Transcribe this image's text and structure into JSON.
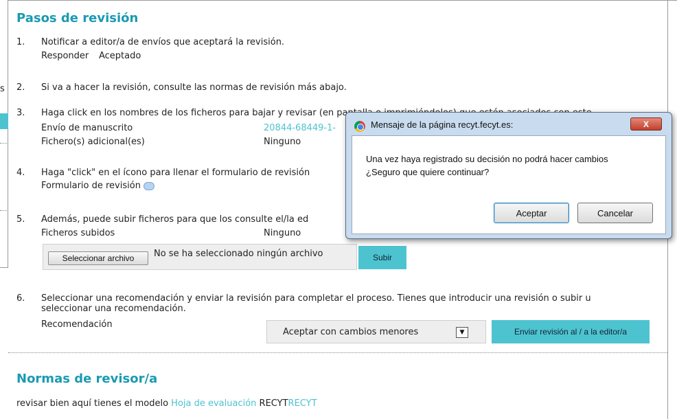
{
  "background_fragment": {
    "text": "s"
  },
  "section_title": "Pasos de revisión",
  "steps": [
    {
      "num": "1.",
      "text": "Notificar a editor/a de envíos que aceptará la revisión.",
      "sub": [
        "Responder",
        "Aceptado"
      ]
    },
    {
      "num": "2.",
      "text": "Si va a hacer la revisión, consulte las normas de revisión más abajo."
    },
    {
      "num": "3.",
      "text": "Haga click en los nombres de los ficheros para bajar y revisar (en pantalla o imprimiéndolos) que estén asociados con este",
      "rows": [
        {
          "label": "Envío de manuscrito",
          "value": "20844-68449-1-"
        },
        {
          "label": "Fichero(s) adicional(es)",
          "value": "Ninguno"
        }
      ]
    },
    {
      "num": "4.",
      "text": "Haga \"click\" en el ícono para llenar el formulario de revisión",
      "sub_label": "Formulario de revisión"
    },
    {
      "num": "5.",
      "text": "Además, puede subir ficheros para que los consulte el/la ed",
      "row": {
        "label": "Ficheros subidos",
        "value": "Ninguno"
      },
      "file_button": "Seleccionar archivo",
      "file_status": "No se ha seleccionado ningún archivo",
      "upload_button": "Subir"
    },
    {
      "num": "6.",
      "text": "Seleccionar una recomendación y enviar la revisión para completar el proceso. Tienes que introducir una revisión o subir u",
      "text2": "seleccionar una recomendación.",
      "label": "Recomendación",
      "select_value": "Aceptar con cambios menores",
      "submit_button": "Enviar revisión al / a la editor/a"
    }
  ],
  "norms": {
    "title": "Normas de revisor/a",
    "text_before": "revisar bien aquí tienes el modelo ",
    "link": "Hoja de evaluación",
    "text_mid": " RECYT",
    "link2": "RECYT"
  },
  "dialog": {
    "title": "Mensaje de la página recyt.fecyt.es:",
    "close": "X",
    "line1": "Una vez haya registrado su decisión no podrá hacer cambios",
    "line2": "¿Seguro que quiere continuar?",
    "accept": "Aceptar",
    "cancel": "Cancelar",
    "icon": "chrome-icon"
  },
  "colors": {
    "accent": "#1a9ab2",
    "teal": "#4ec3d0",
    "dialog_frame": "#c9dcef",
    "close_red": "#c1402d"
  }
}
